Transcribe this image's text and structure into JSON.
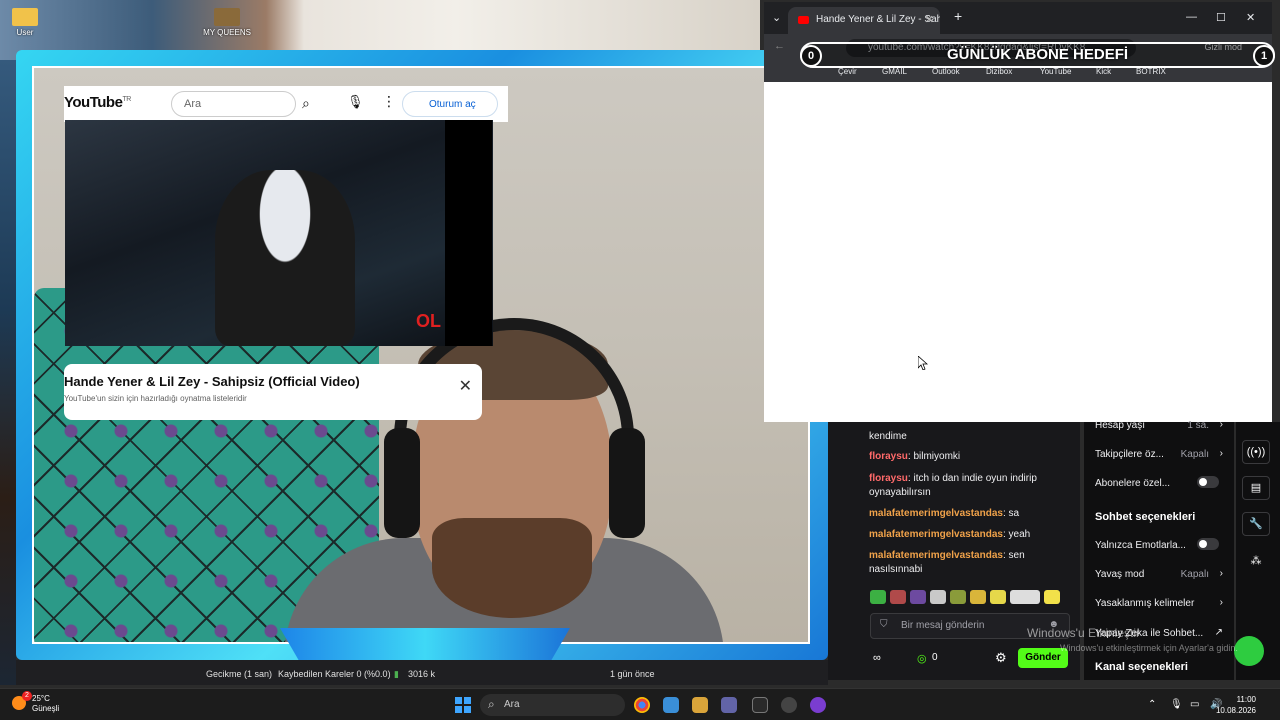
{
  "desktop": {
    "icons": [
      {
        "label": "User"
      },
      {
        "label": "MY QUEENS"
      }
    ]
  },
  "goal": {
    "title": "GÜNLÜK ABONE HEDEFİ",
    "current": "0",
    "target": "1"
  },
  "browser": {
    "tab_title": "Hande Yener & Lil Zey - Sah",
    "url": "youtube.com/watch?v=KK8zdqdag&list=RDvKK8",
    "incognito": "Gizli mod",
    "bookmarks": [
      "Çevir",
      "GMAIL",
      "Outlook",
      "Dizibox",
      "YouTube",
      "Kick",
      "BOTRIX"
    ],
    "youtube": {
      "logo": "YouTube",
      "region": "TR",
      "search_placeholder": "Ara",
      "signin": "Oturum aç",
      "video_badge": "OL",
      "video_title": "Hande Yener & Lil Zey - Sahipsiz (Official Video)",
      "video_subtitle": "YouTube'un sizin için hazırladığı oynatma listeleridir"
    }
  },
  "chat": {
    "messages": [
      {
        "user": "",
        "text": "kendime"
      },
      {
        "user": "floraysu",
        "text": "bilmiyomki"
      },
      {
        "user": "floraysu",
        "text": "itch io dan indie oyun indirip oynayabilırsın"
      },
      {
        "user": "malafatemerimgelvastandas",
        "text": "sa"
      },
      {
        "user": "malafatemerimgelvastandas",
        "text": "yeah"
      },
      {
        "user": "malafatemerimgelvastandas",
        "text": "sen nasılsınnabi"
      }
    ],
    "input_placeholder": "Bir mesaj gönderin",
    "points": "0",
    "send_label": "Gönder",
    "bottom_time": "1 gün önce"
  },
  "settings": {
    "rows": [
      {
        "label": "Hesap yaşı",
        "value": "1 sa."
      },
      {
        "label": "Takipçilere öz...",
        "value": "Kapalı"
      },
      {
        "label": "Abonelere özel...",
        "value": ""
      }
    ],
    "chat_options_title": "Sohbet seçenekleri",
    "chat_rows": [
      {
        "label": "Yalnızca Emotlarla...",
        "value": ""
      },
      {
        "label": "Yavaş mod",
        "value": "Kapalı"
      },
      {
        "label": "Yasaklanmış kelimeler",
        "value": ""
      },
      {
        "label": "Yapay Zeka ile Sohbet...",
        "value": ""
      }
    ],
    "channel_options_title": "Kanal seçenekleri"
  },
  "windows_watermark": {
    "line1": "Windows'u Etkinleştir",
    "line2": "Windows'u etkinleştirmek için Ayarlar'a gidin."
  },
  "obs": {
    "delay": "Gecikme (1 san)",
    "dropped": "Kaybedilen Kareler 0 (%0.0)",
    "bitrate": "3016 k"
  },
  "taskbar": {
    "weather_temp": "25°C",
    "weather_desc": "Güneşli",
    "weather_badge": "2",
    "search_placeholder": "Ara",
    "time": "11:00",
    "date": "10.08.2026"
  },
  "colors": {
    "kick_green": "#53fc18",
    "overlay_cyan": "#35d6f2",
    "overlay_blue": "#1a8fe0"
  }
}
